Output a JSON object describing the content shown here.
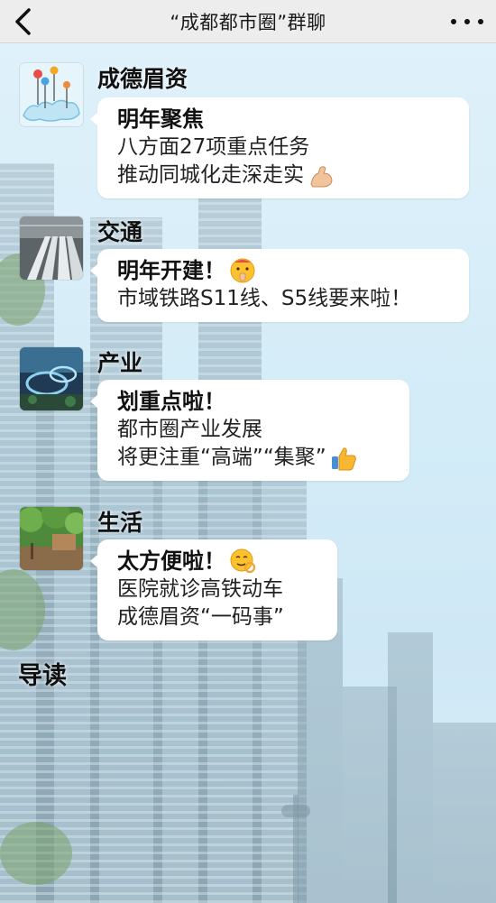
{
  "header": {
    "title": "“成都都市圈”群聊",
    "back_icon": "chevron-left-icon",
    "more_icon": "more-dots-icon"
  },
  "messages": [
    {
      "sender": "成德眉资",
      "avatar": "city-map-avatar",
      "headline": "明年聚焦",
      "lines": [
        "八方面27项重点任务",
        "推动同城化走深走实"
      ],
      "emoji": "flexed-biceps"
    },
    {
      "sender": "交通",
      "avatar": "railway-station-avatar",
      "headline": "明年开建！",
      "headline_emoji": "shushing-face",
      "lines": [
        "市域铁路S11线、S5线要来啦！"
      ]
    },
    {
      "sender": "产业",
      "avatar": "industrial-park-avatar",
      "headline": "划重点啦！",
      "lines": [
        "都市圈产业发展",
        "将更注重“高端”“集聚”"
      ],
      "emoji": "thumbs-up"
    },
    {
      "sender": "生活",
      "avatar": "park-life-avatar",
      "headline": "太方便啦！",
      "headline_emoji": "ok-hand-face",
      "lines": [
        "医院就诊高铁动车",
        "成德眉资“一码事”"
      ]
    }
  ],
  "section": {
    "title": "导读"
  }
}
